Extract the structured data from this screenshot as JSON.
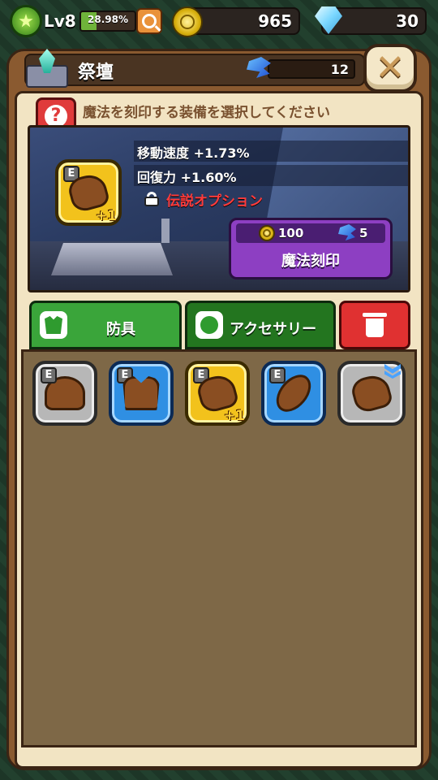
{
  "hud": {
    "level": "Lv8",
    "xp_percent": "28.98%",
    "xp_fraction": 0.29,
    "gold": "965",
    "gems": "30"
  },
  "window": {
    "title": "祭壇",
    "rune_count": "12",
    "instruction": "魔法を刻印する装備を選択してください"
  },
  "selected_item": {
    "grade": "E",
    "upgrade": "+1",
    "stats": [
      "移動速度 +1.73%",
      "回復力 +1.60%"
    ],
    "locked_option": "伝説オプション"
  },
  "engrave": {
    "gold_cost": "100",
    "rune_cost": "5",
    "label": "魔法刻印"
  },
  "tabs": [
    {
      "label": "防具",
      "active": true
    },
    {
      "label": "アクセサリー",
      "active": false
    }
  ],
  "inventory": [
    {
      "grade": "E",
      "rarity": "gray",
      "item": "helmet-icon",
      "upgrade": ""
    },
    {
      "grade": "E",
      "rarity": "blue",
      "item": "vest-icon",
      "upgrade": ""
    },
    {
      "grade": "E",
      "rarity": "gold",
      "item": "glove-icon",
      "upgrade": "+1"
    },
    {
      "grade": "E",
      "rarity": "blue",
      "item": "sandal-icon",
      "upgrade": ""
    },
    {
      "grade": "",
      "rarity": "gray",
      "item": "glove-icon",
      "upgrade": ""
    }
  ],
  "colors": {
    "panel": "#8a5a30",
    "legend_option": "#ff3b3b",
    "engrave_button": "#8d3fc2",
    "tab_green": "#3aa53a",
    "trash_red": "#e03131"
  }
}
